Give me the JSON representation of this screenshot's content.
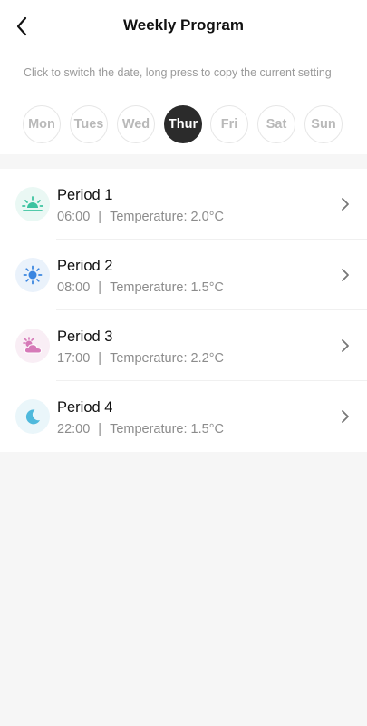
{
  "header": {
    "title": "Weekly Program",
    "back_icon": "chevron-left-icon"
  },
  "hint": "Click to switch the date, long press to copy the current setting",
  "days": [
    {
      "label": "Mon",
      "active": false
    },
    {
      "label": "Tues",
      "active": false
    },
    {
      "label": "Wed",
      "active": false
    },
    {
      "label": "Thur",
      "active": true
    },
    {
      "label": "Fri",
      "active": false
    },
    {
      "label": "Sat",
      "active": false
    },
    {
      "label": "Sun",
      "active": false
    }
  ],
  "periods": [
    {
      "name": "Period 1",
      "time": "06:00",
      "separator": "|",
      "temperature": "Temperature: 2.0°C",
      "icon": "sunrise-icon",
      "icon_color": "#3cc3a0",
      "icon_bg": "#eaf8f4"
    },
    {
      "name": "Period 2",
      "time": "08:00",
      "separator": "|",
      "temperature": "Temperature: 1.5°C",
      "icon": "sun-icon",
      "icon_color": "#3b86e0",
      "icon_bg": "#eaf2fb"
    },
    {
      "name": "Period 3",
      "time": "17:00",
      "separator": "|",
      "temperature": "Temperature: 2.2°C",
      "icon": "cloudy-sun-icon",
      "icon_color": "#d67ab8",
      "icon_bg": "#f9eef5"
    },
    {
      "name": "Period 4",
      "time": "22:00",
      "separator": "|",
      "temperature": "Temperature: 1.5°C",
      "icon": "moon-icon",
      "icon_color": "#4fb9dc",
      "icon_bg": "#eaf6fa"
    }
  ],
  "colors": {
    "active_day_bg": "#2b2b2b",
    "inactive_day_text": "#b9b9b9",
    "page_bg": "#f6f6f6"
  }
}
